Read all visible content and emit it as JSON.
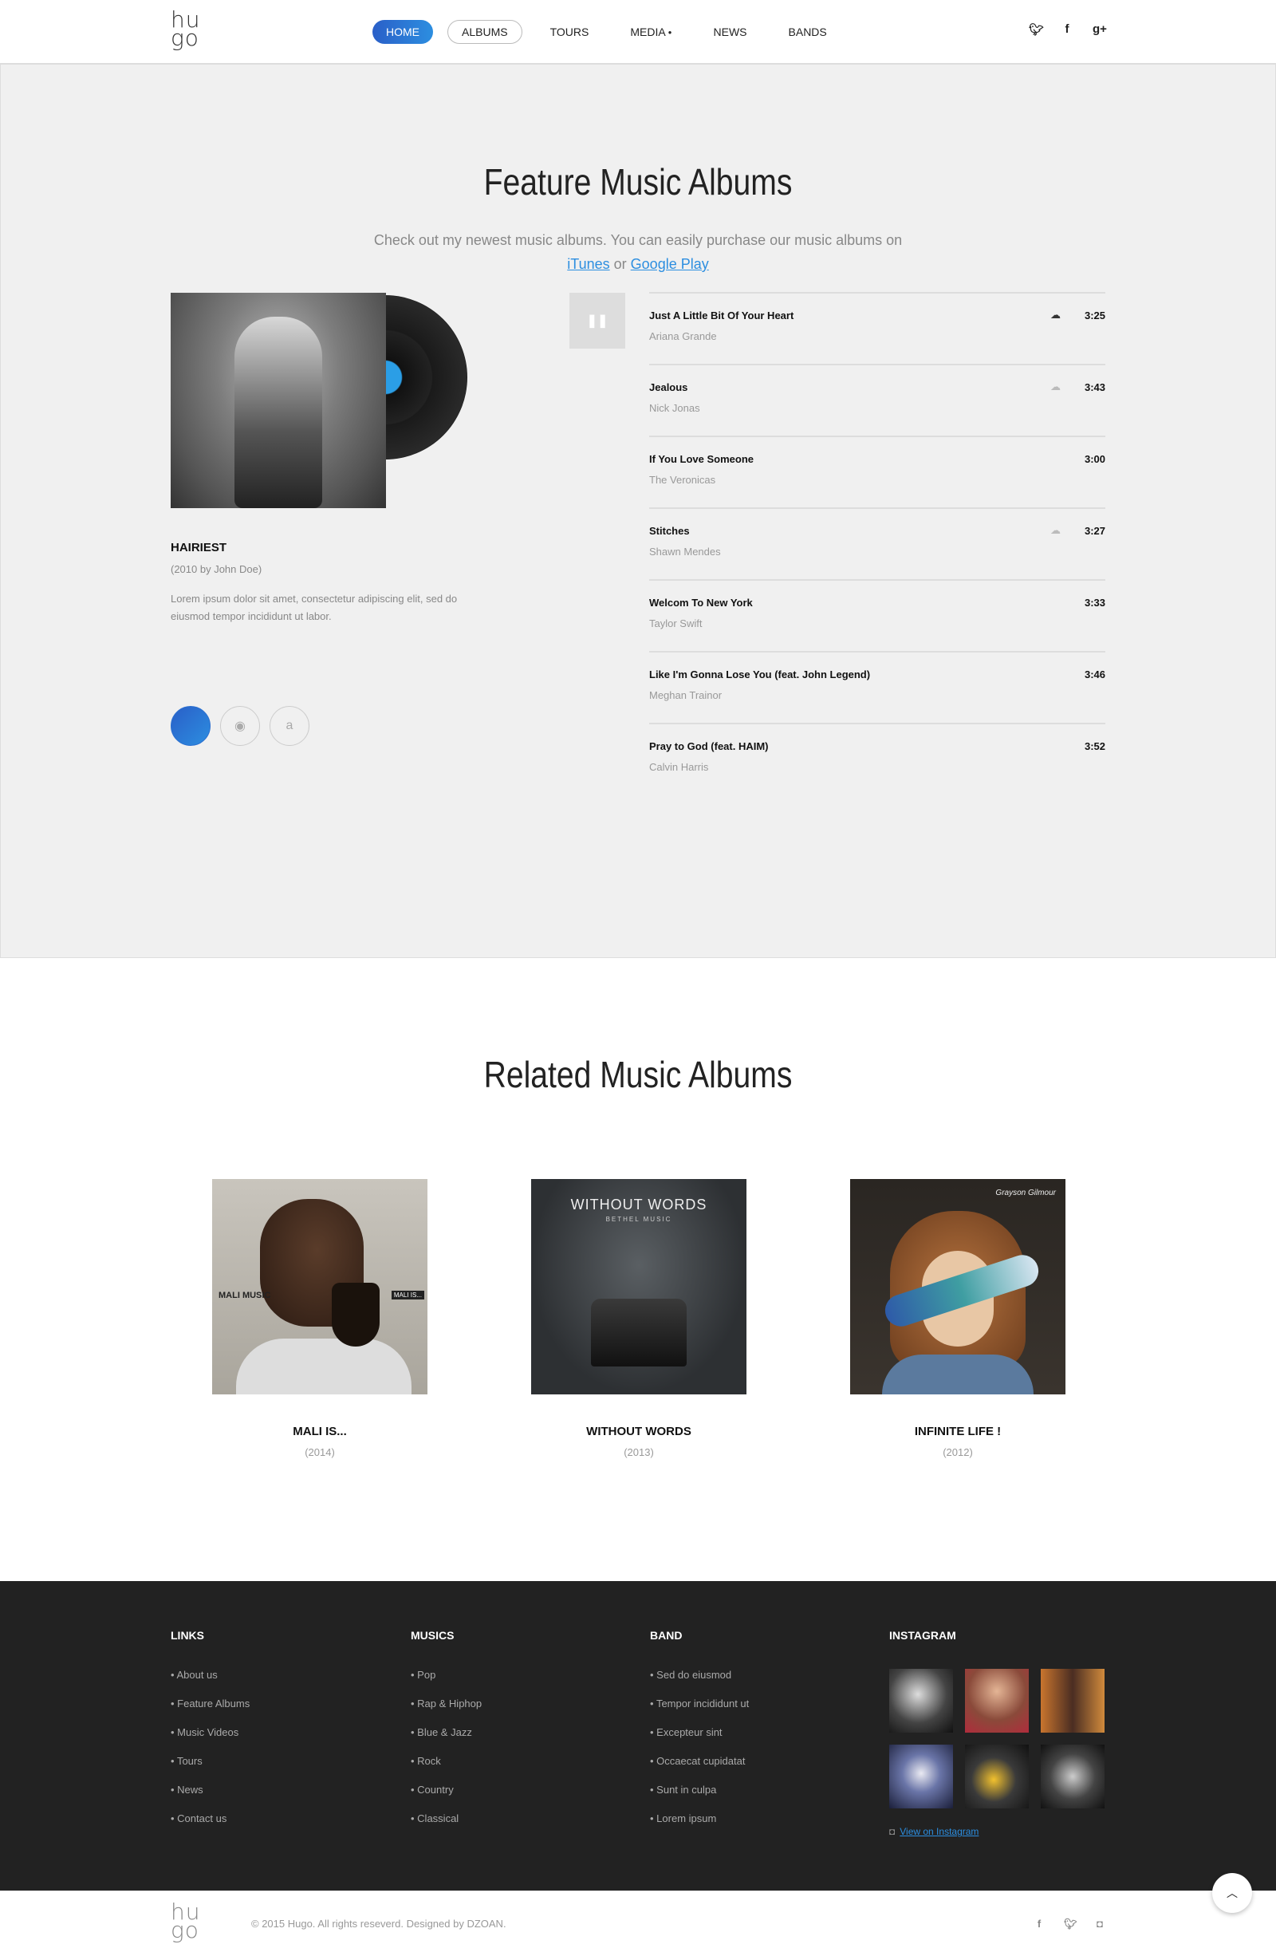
{
  "header": {
    "logo_line1": "hu",
    "logo_line2": "go",
    "nav": [
      "Home",
      "Albums",
      "Tours",
      "Media",
      "News",
      "Bands"
    ],
    "nav_active": "Home",
    "social": {
      "twitter": "twitter-icon",
      "facebook": "facebook-icon",
      "google_plus": "google-plus-icon"
    }
  },
  "featured": {
    "title": "Feature Music Albums",
    "desc_before": "Check out my newest music albums. You can easily purchase our music albums on",
    "link_itunes": "iTunes",
    "desc_or": "or",
    "link_google": "Google Play",
    "album": {
      "name": "HAIRIEST",
      "year": "(2010 by John Doe)",
      "desc": "Lorem ipsum dolor sit amet, consectetur adipiscing elit, sed do eiusmod tempor incididunt ut labor."
    },
    "stores": [
      "apple-icon",
      "spotify-icon",
      "amazon-icon"
    ],
    "tracks": [
      {
        "name": "Just A Little Bit Of Your Heart",
        "artist": "Ariana Grande",
        "time": "3:25",
        "download": "dark"
      },
      {
        "name": "Jealous",
        "artist": "Nick Jonas",
        "time": "3:43",
        "download": "light"
      },
      {
        "name": "If You Love Someone",
        "artist": "The Veronicas",
        "time": "3:00",
        "download": "none"
      },
      {
        "name": "Stitches",
        "artist": "Shawn Mendes",
        "time": "3:27",
        "download": "light"
      },
      {
        "name": "Welcom To New York",
        "artist": "Taylor Swift",
        "time": "3:33",
        "download": "none"
      },
      {
        "name": "Like I'm Gonna Lose You (feat. John Legend)",
        "artist": "Meghan Trainor",
        "time": "3:46",
        "download": "none"
      },
      {
        "name": "Pray to God (feat. HAIM)",
        "artist": "Calvin Harris",
        "time": "3:52",
        "download": "none"
      }
    ]
  },
  "related": {
    "title": "Related Music Albums",
    "albums": [
      {
        "name": "MALI IS...",
        "year": "(2014)",
        "cover_text_1": "MALI MUSIC",
        "cover_text_2": "MALI IS..."
      },
      {
        "name": "WITHOUT WORDS",
        "year": "(2013)",
        "cover_text_1": "WITHOUT WORDS",
        "cover_text_2": "BETHEL MUSIC"
      },
      {
        "name": "INFINITE LIFE !",
        "year": "(2012)",
        "cover_text_1": "Grayson Gilmour"
      }
    ]
  },
  "footer": {
    "links": {
      "title": "LINKS",
      "items": [
        "About us",
        "Feature Albums",
        "Music Videos",
        "Tours",
        "News",
        "Contact us"
      ]
    },
    "musics": {
      "title": "MUSICS",
      "items": [
        "Pop",
        "Rap & Hiphop",
        "Blue & Jazz",
        "Rock",
        "Country",
        "Classical"
      ]
    },
    "band": {
      "title": "BAND",
      "items": [
        "Sed do eiusmod",
        "Tempor incididunt ut",
        "Excepteur sint",
        "Occaecat cupidatat",
        "Sunt in culpa",
        "Lorem ipsum"
      ]
    },
    "instagram": {
      "title": "INSTAGRAM",
      "link": "View on Instagram"
    },
    "copyright": "© 2015 Hugo. All rights reseverd. Designed by DZOAN."
  },
  "colors": {
    "accent": "#2c8ee0",
    "accent_dark": "#2a5fc8",
    "footer_bg": "#222222"
  }
}
